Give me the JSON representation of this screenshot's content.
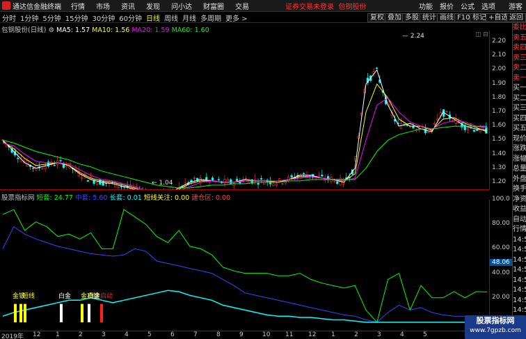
{
  "menubar": {
    "app_title": "通达信金融终端",
    "menus": [
      "行情",
      "市场",
      "资讯",
      "发现",
      "问小达",
      "财富圈",
      "交易"
    ],
    "warning": "证券交易未登录",
    "stock_link": "包钢股份",
    "right": [
      "功能",
      "报价",
      "公式",
      "选项",
      "游客"
    ]
  },
  "toolbar": {
    "periods": [
      "分时",
      "1分钟",
      "5分钟",
      "15分钟",
      "30分钟",
      "60分钟",
      "日线",
      "周线",
      "月线",
      "多周期",
      "更多 >"
    ],
    "active_period": "日线",
    "right_buttons": [
      "复权",
      "叠加",
      "多股",
      "统计",
      "画线",
      "F10",
      "标记",
      "+自选",
      "返回"
    ]
  },
  "ma_legend": {
    "stock": "包钢股份(日线)",
    "ma5": "MA5: 1.57",
    "ma10": "MA10: 1.56",
    "ma20": "MA20: 1.59",
    "ma60": "MA60: 1.60"
  },
  "main_axis": [
    "2.20",
    "2.10",
    "2.00",
    "1.90",
    "1.80",
    "1.70",
    "1.60",
    "1.50",
    "1.40",
    "1.30",
    "1.20"
  ],
  "price_labels": {
    "high": "2.24",
    "low": "1.04"
  },
  "sidebar": [
    "委比",
    "卖五",
    "卖四",
    "卖三",
    "卖二",
    "卖一",
    "买一",
    "买二",
    "买三",
    "买四",
    "买五",
    "现价",
    "涨跌",
    "涨幅",
    "总量",
    "外盘",
    "换手",
    "净资",
    "收益",
    "自动",
    "行情",
    "14:5",
    "14:5",
    "14:5",
    "14:5",
    "14:5",
    "14:5",
    "14:5",
    "14:5",
    "14:5",
    "14:5",
    "14:5"
  ],
  "indicator_legend": {
    "name": "股票指标网",
    "short": "短套: 24.77",
    "mid": "中套: 5.60",
    "long": "长套: 0.01",
    "focus": "短线关注: 0.00",
    "build": "建仓区: 0.00"
  },
  "ind_axis": [
    "100.0",
    "80.00",
    "60.00",
    "40.00",
    "20.00"
  ],
  "ind_current": "48.06",
  "ind_labels": [
    "金银",
    "短线",
    "白金",
    "金项链",
    "白金",
    "启动"
  ],
  "dates": [
    "2019年",
    "12",
    "1",
    "2",
    "3",
    "4",
    "5",
    "6",
    "7",
    "8",
    "9",
    "10",
    "11",
    "12",
    "1",
    "2",
    "3",
    "4",
    "5"
  ],
  "watermark": {
    "line1": "股票指标网",
    "line2": "www.7gpzb.com"
  },
  "colors": {
    "ma5": "#ffffff",
    "ma10": "#ffff00",
    "ma20": "#ff00ff",
    "ma60": "#00ff00",
    "short": "#00ff00",
    "mid": "#4040ff",
    "long": "#00ffff"
  },
  "chart_data": [
    {
      "type": "candlestick",
      "title": "包钢股份(日线)",
      "ylim": [
        1.04,
        2.24
      ],
      "series": [
        {
          "name": "MA5",
          "values": [
            1.5,
            1.42,
            1.34,
            1.3,
            1.32,
            1.34,
            1.32,
            1.26,
            1.22,
            1.2,
            1.19,
            1.17,
            1.15,
            1.12,
            1.1,
            1.12,
            1.16,
            1.2,
            1.22,
            1.21,
            1.2,
            1.2,
            1.22,
            1.21,
            1.21,
            1.2,
            1.22,
            1.25,
            1.25,
            1.23,
            1.22,
            1.2,
            1.3,
            1.9,
            2.0,
            1.75,
            1.6,
            1.62,
            1.58,
            1.56,
            1.7,
            1.65,
            1.6,
            1.58,
            1.57
          ]
        },
        {
          "name": "MA10",
          "values": [
            1.49,
            1.44,
            1.37,
            1.32,
            1.33,
            1.34,
            1.32,
            1.27,
            1.23,
            1.21,
            1.2,
            1.18,
            1.16,
            1.13,
            1.11,
            1.12,
            1.15,
            1.19,
            1.21,
            1.21,
            1.2,
            1.2,
            1.21,
            1.21,
            1.21,
            1.2,
            1.22,
            1.24,
            1.24,
            1.23,
            1.22,
            1.21,
            1.26,
            1.7,
            1.9,
            1.8,
            1.65,
            1.6,
            1.6,
            1.57,
            1.65,
            1.66,
            1.62,
            1.59,
            1.56
          ]
        },
        {
          "name": "MA20",
          "values": [
            1.48,
            1.46,
            1.4,
            1.35,
            1.34,
            1.34,
            1.33,
            1.29,
            1.25,
            1.22,
            1.21,
            1.19,
            1.17,
            1.14,
            1.12,
            1.12,
            1.14,
            1.17,
            1.2,
            1.21,
            1.2,
            1.2,
            1.21,
            1.21,
            1.21,
            1.21,
            1.22,
            1.23,
            1.24,
            1.23,
            1.22,
            1.21,
            1.23,
            1.5,
            1.75,
            1.8,
            1.7,
            1.63,
            1.6,
            1.58,
            1.62,
            1.64,
            1.63,
            1.6,
            1.59
          ]
        },
        {
          "name": "MA60",
          "values": [
            1.5,
            1.48,
            1.45,
            1.42,
            1.4,
            1.38,
            1.36,
            1.33,
            1.31,
            1.28,
            1.26,
            1.24,
            1.22,
            1.2,
            1.18,
            1.17,
            1.16,
            1.16,
            1.17,
            1.18,
            1.18,
            1.19,
            1.19,
            1.2,
            1.2,
            1.2,
            1.21,
            1.21,
            1.22,
            1.22,
            1.22,
            1.22,
            1.22,
            1.3,
            1.42,
            1.5,
            1.54,
            1.56,
            1.58,
            1.58,
            1.59,
            1.6,
            1.6,
            1.6,
            1.6
          ]
        }
      ]
    },
    {
      "type": "line",
      "title": "股票指标网",
      "ylim": [
        0,
        100
      ],
      "series": [
        {
          "name": "短套",
          "values": [
            88,
            92,
            75,
            82,
            78,
            70,
            72,
            68,
            73,
            60,
            60,
            92,
            86,
            80,
            70,
            65,
            75,
            62,
            60,
            55,
            45,
            42,
            40,
            40,
            40,
            38,
            38,
            40,
            35,
            32,
            30,
            28,
            30,
            10,
            0,
            35,
            40,
            10,
            30,
            20,
            20,
            25,
            20,
            25,
            24.77
          ]
        },
        {
          "name": "中套",
          "values": [
            60,
            78,
            72,
            68,
            65,
            62,
            60,
            58,
            56,
            55,
            54,
            55,
            60,
            58,
            50,
            48,
            46,
            44,
            42,
            40,
            35,
            30,
            24,
            22,
            20,
            18,
            16,
            14,
            12,
            10,
            8,
            6,
            5,
            2,
            0,
            8,
            14,
            10,
            12,
            8,
            6,
            5,
            5,
            5,
            5.6
          ]
        },
        {
          "name": "长套",
          "values": [
            5,
            8,
            10,
            12,
            14,
            16,
            18,
            18,
            20,
            18,
            16,
            18,
            20,
            22,
            24,
            26,
            25,
            22,
            20,
            18,
            14,
            12,
            10,
            8,
            6,
            5,
            5,
            4,
            4,
            3,
            2,
            2,
            1,
            0,
            0,
            0,
            0,
            0,
            0,
            0,
            0,
            0,
            0,
            0,
            0.01
          ]
        }
      ]
    }
  ]
}
